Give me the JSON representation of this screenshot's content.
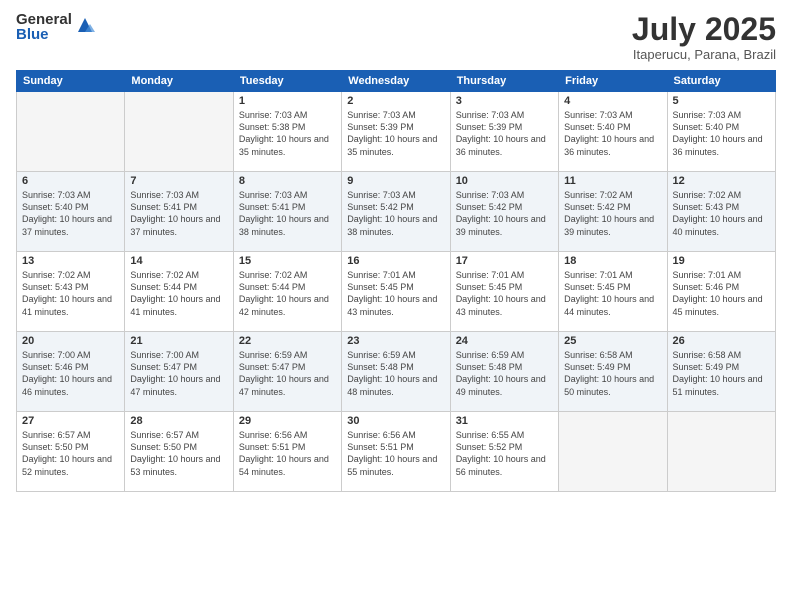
{
  "header": {
    "logo_general": "General",
    "logo_blue": "Blue",
    "month_year": "July 2025",
    "location": "Itaperucu, Parana, Brazil"
  },
  "days_of_week": [
    "Sunday",
    "Monday",
    "Tuesday",
    "Wednesday",
    "Thursday",
    "Friday",
    "Saturday"
  ],
  "weeks": [
    [
      {
        "day": "",
        "info": ""
      },
      {
        "day": "",
        "info": ""
      },
      {
        "day": "1",
        "info": "Sunrise: 7:03 AM\nSunset: 5:38 PM\nDaylight: 10 hours and 35 minutes."
      },
      {
        "day": "2",
        "info": "Sunrise: 7:03 AM\nSunset: 5:39 PM\nDaylight: 10 hours and 35 minutes."
      },
      {
        "day": "3",
        "info": "Sunrise: 7:03 AM\nSunset: 5:39 PM\nDaylight: 10 hours and 36 minutes."
      },
      {
        "day": "4",
        "info": "Sunrise: 7:03 AM\nSunset: 5:40 PM\nDaylight: 10 hours and 36 minutes."
      },
      {
        "day": "5",
        "info": "Sunrise: 7:03 AM\nSunset: 5:40 PM\nDaylight: 10 hours and 36 minutes."
      }
    ],
    [
      {
        "day": "6",
        "info": "Sunrise: 7:03 AM\nSunset: 5:40 PM\nDaylight: 10 hours and 37 minutes."
      },
      {
        "day": "7",
        "info": "Sunrise: 7:03 AM\nSunset: 5:41 PM\nDaylight: 10 hours and 37 minutes."
      },
      {
        "day": "8",
        "info": "Sunrise: 7:03 AM\nSunset: 5:41 PM\nDaylight: 10 hours and 38 minutes."
      },
      {
        "day": "9",
        "info": "Sunrise: 7:03 AM\nSunset: 5:42 PM\nDaylight: 10 hours and 38 minutes."
      },
      {
        "day": "10",
        "info": "Sunrise: 7:03 AM\nSunset: 5:42 PM\nDaylight: 10 hours and 39 minutes."
      },
      {
        "day": "11",
        "info": "Sunrise: 7:02 AM\nSunset: 5:42 PM\nDaylight: 10 hours and 39 minutes."
      },
      {
        "day": "12",
        "info": "Sunrise: 7:02 AM\nSunset: 5:43 PM\nDaylight: 10 hours and 40 minutes."
      }
    ],
    [
      {
        "day": "13",
        "info": "Sunrise: 7:02 AM\nSunset: 5:43 PM\nDaylight: 10 hours and 41 minutes."
      },
      {
        "day": "14",
        "info": "Sunrise: 7:02 AM\nSunset: 5:44 PM\nDaylight: 10 hours and 41 minutes."
      },
      {
        "day": "15",
        "info": "Sunrise: 7:02 AM\nSunset: 5:44 PM\nDaylight: 10 hours and 42 minutes."
      },
      {
        "day": "16",
        "info": "Sunrise: 7:01 AM\nSunset: 5:45 PM\nDaylight: 10 hours and 43 minutes."
      },
      {
        "day": "17",
        "info": "Sunrise: 7:01 AM\nSunset: 5:45 PM\nDaylight: 10 hours and 43 minutes."
      },
      {
        "day": "18",
        "info": "Sunrise: 7:01 AM\nSunset: 5:45 PM\nDaylight: 10 hours and 44 minutes."
      },
      {
        "day": "19",
        "info": "Sunrise: 7:01 AM\nSunset: 5:46 PM\nDaylight: 10 hours and 45 minutes."
      }
    ],
    [
      {
        "day": "20",
        "info": "Sunrise: 7:00 AM\nSunset: 5:46 PM\nDaylight: 10 hours and 46 minutes."
      },
      {
        "day": "21",
        "info": "Sunrise: 7:00 AM\nSunset: 5:47 PM\nDaylight: 10 hours and 47 minutes."
      },
      {
        "day": "22",
        "info": "Sunrise: 6:59 AM\nSunset: 5:47 PM\nDaylight: 10 hours and 47 minutes."
      },
      {
        "day": "23",
        "info": "Sunrise: 6:59 AM\nSunset: 5:48 PM\nDaylight: 10 hours and 48 minutes."
      },
      {
        "day": "24",
        "info": "Sunrise: 6:59 AM\nSunset: 5:48 PM\nDaylight: 10 hours and 49 minutes."
      },
      {
        "day": "25",
        "info": "Sunrise: 6:58 AM\nSunset: 5:49 PM\nDaylight: 10 hours and 50 minutes."
      },
      {
        "day": "26",
        "info": "Sunrise: 6:58 AM\nSunset: 5:49 PM\nDaylight: 10 hours and 51 minutes."
      }
    ],
    [
      {
        "day": "27",
        "info": "Sunrise: 6:57 AM\nSunset: 5:50 PM\nDaylight: 10 hours and 52 minutes."
      },
      {
        "day": "28",
        "info": "Sunrise: 6:57 AM\nSunset: 5:50 PM\nDaylight: 10 hours and 53 minutes."
      },
      {
        "day": "29",
        "info": "Sunrise: 6:56 AM\nSunset: 5:51 PM\nDaylight: 10 hours and 54 minutes."
      },
      {
        "day": "30",
        "info": "Sunrise: 6:56 AM\nSunset: 5:51 PM\nDaylight: 10 hours and 55 minutes."
      },
      {
        "day": "31",
        "info": "Sunrise: 6:55 AM\nSunset: 5:52 PM\nDaylight: 10 hours and 56 minutes."
      },
      {
        "day": "",
        "info": ""
      },
      {
        "day": "",
        "info": ""
      }
    ]
  ]
}
